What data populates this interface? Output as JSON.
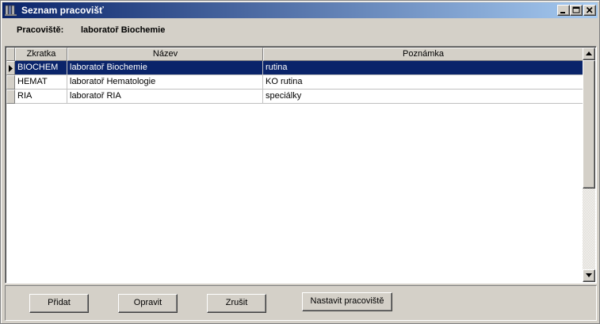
{
  "window": {
    "title": "Seznam pracovišť"
  },
  "header": {
    "label": "Pracoviště:",
    "value": "laboratoř Biochemie"
  },
  "grid": {
    "columns": [
      "Zkratka",
      "Název",
      "Poznámka"
    ],
    "rows": [
      {
        "zkratka": "BIOCHEM",
        "nazev": "laboratoř Biochemie",
        "poznamka": "rutina",
        "selected": true
      },
      {
        "zkratka": "HEMAT",
        "nazev": "laboratoř Hematologie",
        "poznamka": "KO rutina",
        "selected": false
      },
      {
        "zkratka": "RIA",
        "nazev": "laboratoř RIA",
        "poznamka": "speciálky",
        "selected": false
      }
    ]
  },
  "buttons": {
    "add": "Přidat",
    "edit": "Opravit",
    "cancel": "Zrušit",
    "set": "Nastavit pracoviště"
  },
  "colors": {
    "titlebar": "#0a246a",
    "selection": "#0a246a",
    "face": "#d4d0c8"
  }
}
